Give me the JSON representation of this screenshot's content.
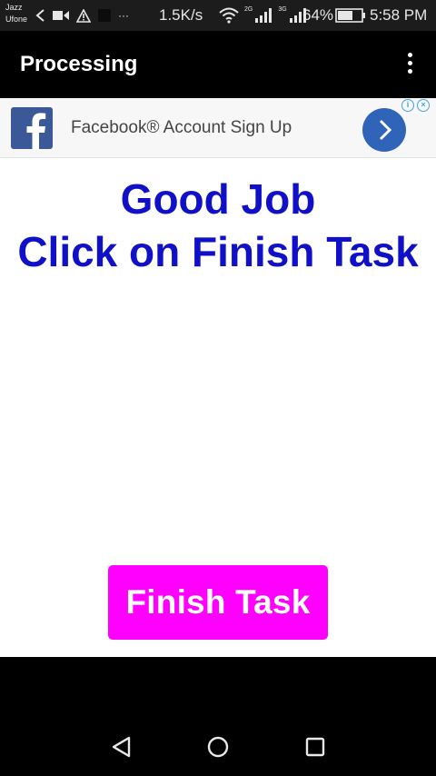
{
  "status_bar": {
    "carrier_top": "Jazz",
    "carrier_bottom": "Ufone",
    "overflow_dots": "···",
    "net_speed": "1.5K/s",
    "net_label_1": "2G",
    "net_label_2": "3G",
    "battery_percent": "64%",
    "battery_level": 0.64,
    "time": "5:58 PM",
    "icons": [
      "carrier-back-arrow-icon",
      "video-camera-icon",
      "warning-icon",
      "notification-square-icon",
      "wifi-icon",
      "signal-icon",
      "signal-icon",
      "battery-icon"
    ]
  },
  "app_bar": {
    "title": "Processing",
    "menu_icon": "more-vert-icon"
  },
  "ad": {
    "text": "Facebook® Account Sign Up",
    "logo_icon": "facebook-logo-icon",
    "arrow_icon": "chevron-right-icon",
    "choices_icons": [
      "info-icon",
      "close-icon"
    ]
  },
  "main": {
    "headline_line1": "Good Job",
    "headline_line2": "Click on Finish Task",
    "finish_button_label": "Finish Task"
  },
  "nav_bar": {
    "icons": [
      "back-triangle-icon",
      "home-circle-icon",
      "recents-square-icon"
    ]
  },
  "colors": {
    "headline": "#1010c8",
    "finish_button": "#ff00ff",
    "app_bar": "#000000",
    "ad_arrow": "#2f64b9",
    "facebook_blue": "#3b5998"
  }
}
